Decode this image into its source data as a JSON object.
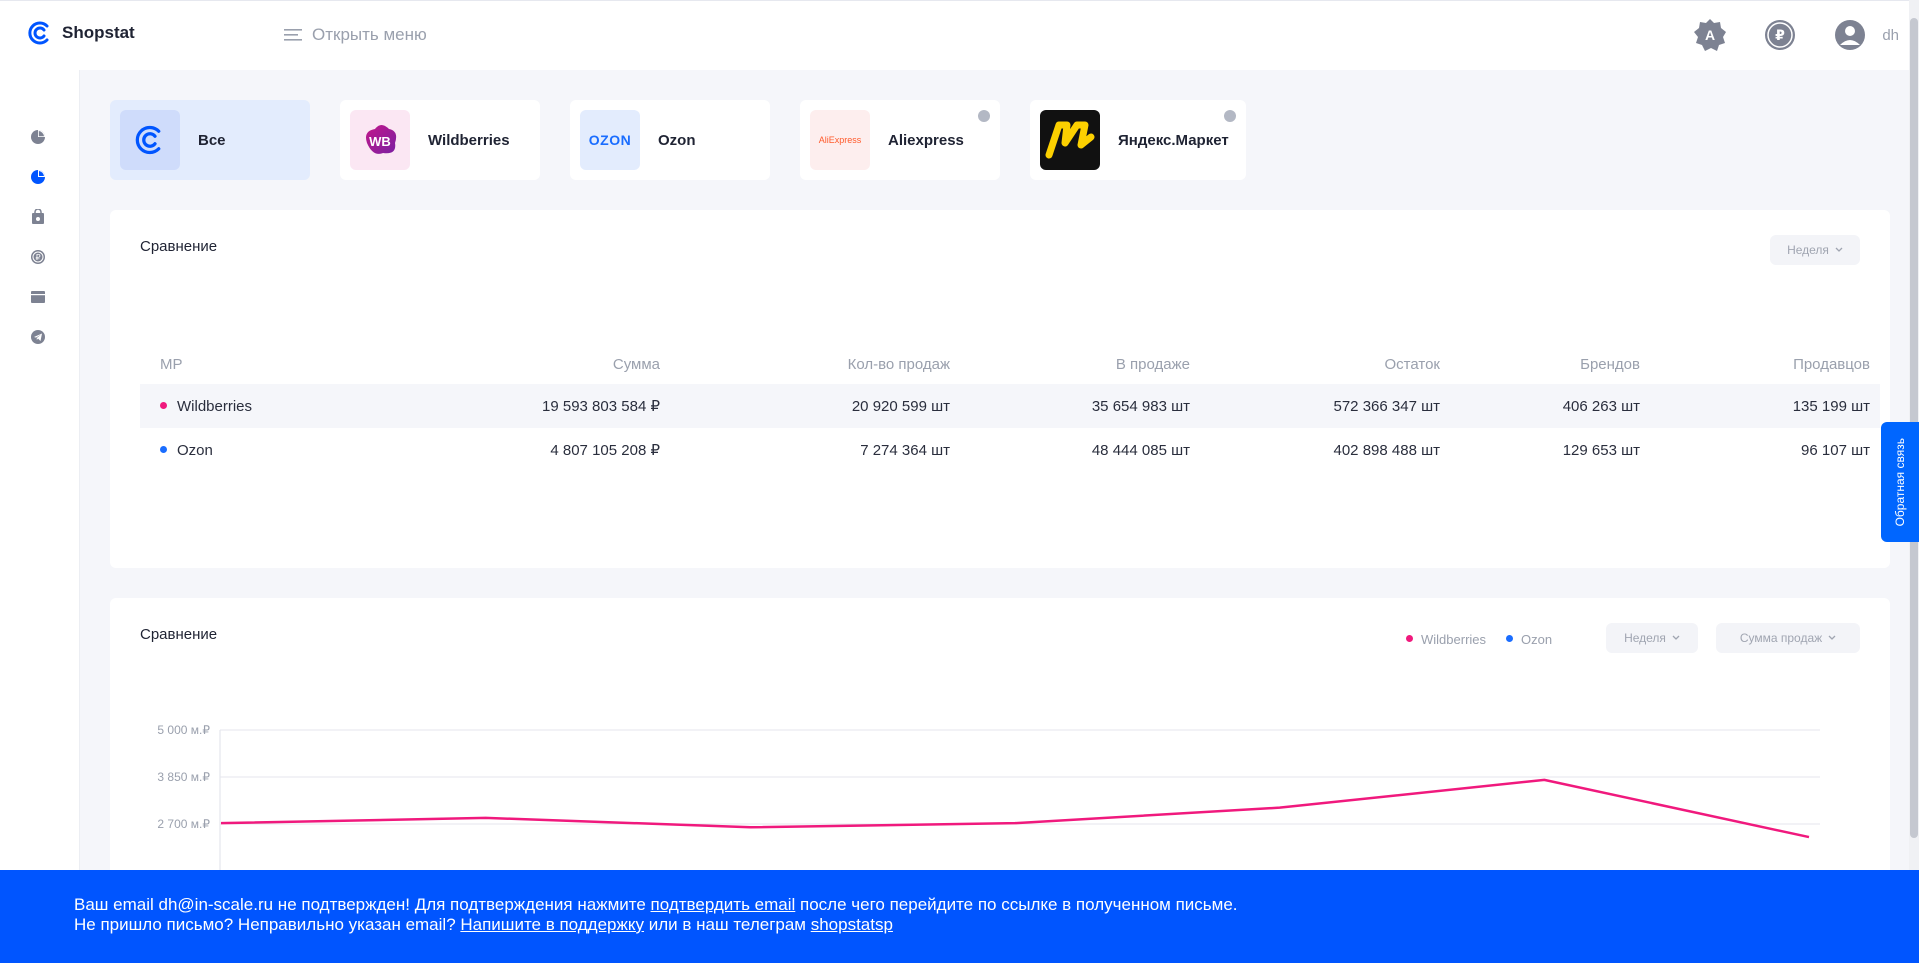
{
  "brand": {
    "name": "Shopstat",
    "color": "#0055ff"
  },
  "header": {
    "menu_label": "Открыть меню",
    "user_name": "dh",
    "icons": [
      "badge-a-icon",
      "ruble-icon",
      "user-avatar-icon"
    ]
  },
  "sidebar": {
    "items": [
      "pie-chart-icon",
      "donut-chart-icon",
      "bag-icon",
      "ruble-circle-icon",
      "calendar-icon",
      "telegram-icon"
    ]
  },
  "marketplaces": [
    {
      "label": "Все",
      "active": true
    },
    {
      "label": "Wildberries",
      "logo_text": "WB"
    },
    {
      "label": "Ozon",
      "logo_text": "OZON"
    },
    {
      "label": "Aliexpress",
      "logo_text": "AliExpress"
    },
    {
      "label": "Яндекс.Маркет"
    }
  ],
  "comparison_table": {
    "title": "Сравнение",
    "period": "Неделя",
    "columns": [
      "МР",
      "Сумма",
      "Кол-во продаж",
      "В продаже",
      "Остаток",
      "Брендов",
      "Продавцов"
    ],
    "rows": [
      {
        "mp": "Wildberries",
        "color": "#f0197d",
        "sum": "19 593 803 584 ₽",
        "sales": "20 920 599 шт",
        "on_sale": "35 654 983 шт",
        "stock": "572 366 347 шт",
        "brands": "406 263 шт",
        "sellers": "135 199 шт"
      },
      {
        "mp": "Ozon",
        "color": "#1a6dff",
        "sum": "4 807 105 208 ₽",
        "sales": "7 274 364 шт",
        "on_sale": "48 444 085 шт",
        "stock": "402 898 488 шт",
        "brands": "129 653 шт",
        "sellers": "96 107 шт"
      }
    ]
  },
  "comparison_chart": {
    "title": "Сравнение",
    "period": "Неделя",
    "metric": "Сумма продаж",
    "legend": [
      "Wildberries",
      "Ozon"
    ]
  },
  "chart_data": {
    "type": "line",
    "y_ticks": [
      "5 000 м.₽",
      "3 850 м.₽",
      "2 700 м.₽"
    ],
    "y_tick_values": [
      5000,
      3850,
      2700
    ],
    "series": [
      {
        "name": "Wildberries",
        "color": "#f0197d",
        "values": [
          2720,
          2850,
          2620,
          2720,
          3100,
          3780,
          2380
        ]
      }
    ]
  },
  "feedback": {
    "label": "Обратная связь"
  },
  "banner": {
    "line1_prefix": "Ваш email dh@in-scale.ru не подтвержден! Для подтверждения нажмите ",
    "line1_link": "подтвердить email",
    "line1_suffix": " после чего перейдите по ссылке в полученном письме.",
    "line2_prefix": "Не пришло письмо? Неправильно указан email? ",
    "line2_link": "Напишите в поддержку",
    "line2_middle": " или в наш телеграм ",
    "line2_link2": "shopstatsp"
  }
}
